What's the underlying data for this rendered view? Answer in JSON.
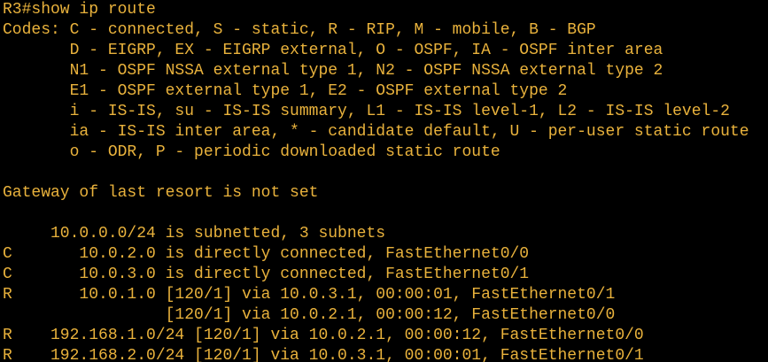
{
  "terminal": {
    "foreground": "#e9b23c",
    "background": "#000000",
    "lines": [
      "R3#show ip route",
      "Codes: C - connected, S - static, R - RIP, M - mobile, B - BGP",
      "       D - EIGRP, EX - EIGRP external, O - OSPF, IA - OSPF inter area",
      "       N1 - OSPF NSSA external type 1, N2 - OSPF NSSA external type 2",
      "       E1 - OSPF external type 1, E2 - OSPF external type 2",
      "       i - IS-IS, su - IS-IS summary, L1 - IS-IS level-1, L2 - IS-IS level-2",
      "       ia - IS-IS inter area, * - candidate default, U - per-user static route",
      "       o - ODR, P - periodic downloaded static route",
      "",
      "Gateway of last resort is not set",
      "",
      "     10.0.0.0/24 is subnetted, 3 subnets",
      "C       10.0.2.0 is directly connected, FastEthernet0/0",
      "C       10.0.3.0 is directly connected, FastEthernet0/1",
      "R       10.0.1.0 [120/1] via 10.0.3.1, 00:00:01, FastEthernet0/1",
      "                 [120/1] via 10.0.2.1, 00:00:12, FastEthernet0/0",
      "R    192.168.1.0/24 [120/1] via 10.0.2.1, 00:00:12, FastEthernet0/0",
      "R    192.168.2.0/24 [120/1] via 10.0.3.1, 00:00:01, FastEthernet0/1"
    ]
  }
}
